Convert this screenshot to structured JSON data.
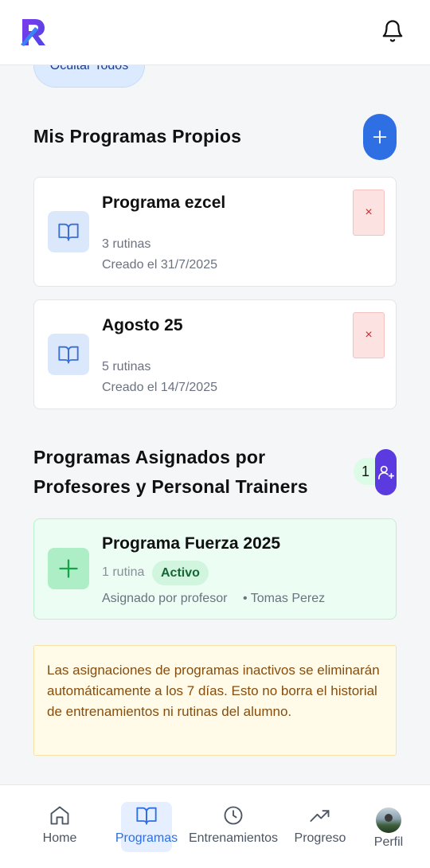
{
  "header": {
    "logo_letter": "R",
    "bell_icon": "bell-icon"
  },
  "top_button": {
    "label": "Ocultar Todos"
  },
  "own_programs": {
    "title": "Mis Programas Propios",
    "add_icon": "plus-icon",
    "items": [
      {
        "name": "Programa ezcel",
        "routines": "3 rutinas",
        "created": "Creado el 31/7/2025",
        "icon": "book-icon",
        "delete_label": "×"
      },
      {
        "name": "Agosto 25",
        "routines": "5 rutinas",
        "created": "Creado el 14/7/2025",
        "icon": "book-icon",
        "delete_label": "×"
      }
    ]
  },
  "assigned_programs": {
    "title_line1": "Programas Asignados por",
    "title_line2": "Profesores y Personal Trainers",
    "count": "1",
    "assign_icon": "user-plus-icon",
    "items": [
      {
        "name": "Programa Fuerza 2025",
        "routines": "1 rutina",
        "status": "Activo",
        "assigned_by": "Asignado por profesor",
        "teacher": "• Tomas Perez",
        "icon": "plus-icon"
      }
    ]
  },
  "notice": {
    "text": "Las asignaciones de programas inactivos se eliminarán automáticamente a los 7 días. Esto no borra el historial de entrenamientos ni rutinas del alumno."
  },
  "bottom_nav": {
    "items": [
      {
        "label": "Home",
        "icon": "home-icon"
      },
      {
        "label": "Programas",
        "icon": "book-icon",
        "active": true
      },
      {
        "label": "Entrenamientos",
        "icon": "clock-icon"
      },
      {
        "label": "Progreso",
        "icon": "trending-up-icon"
      },
      {
        "label": "Perfil",
        "icon": "avatar"
      }
    ]
  },
  "colors": {
    "primary": "#2f6fe4",
    "accent_purple": "#5b3be0",
    "success_bg": "#ecfdf3",
    "warning_bg": "#fffbe8",
    "danger_bg": "#fde2e2"
  }
}
